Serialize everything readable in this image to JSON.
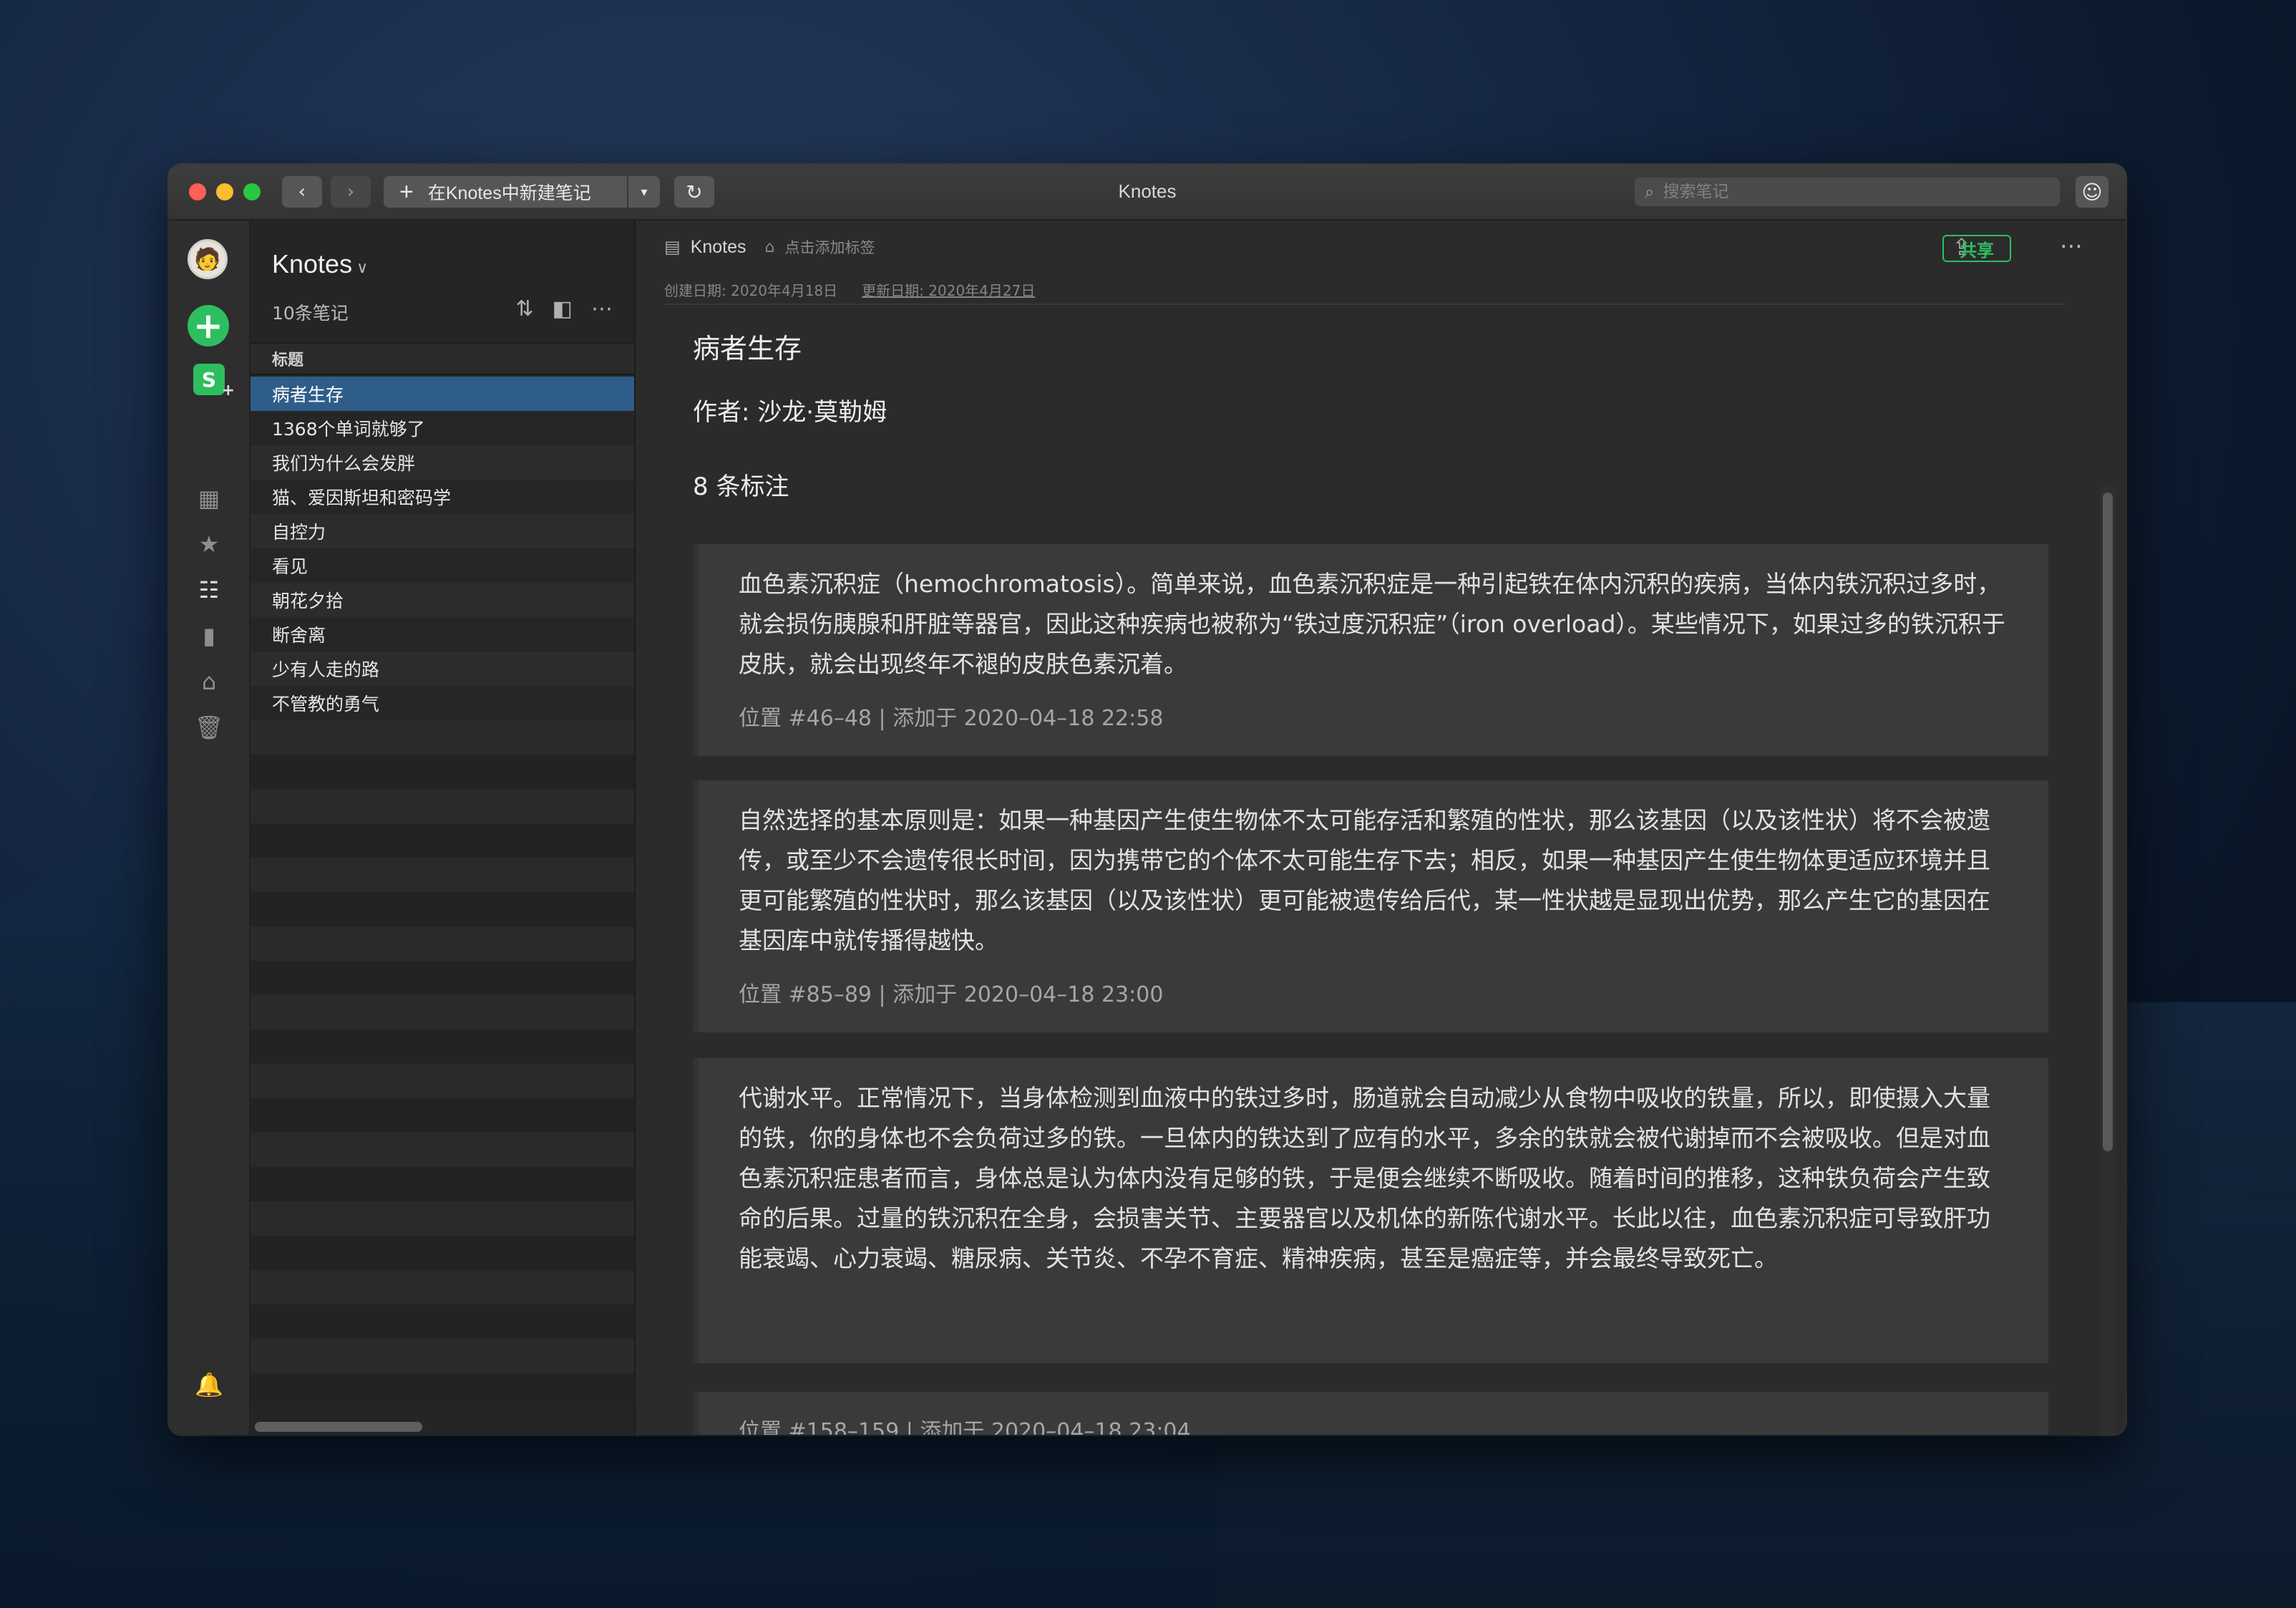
{
  "window": {
    "title": "Knotes",
    "new_note_label": "在Knotes中新建笔记",
    "search_placeholder": "搜索笔记"
  },
  "icons": {
    "back": "chevron-left-icon",
    "forward": "chevron-right-icon",
    "sync": "sync-icon",
    "search": "search-icon",
    "emoji": "smiley-icon"
  },
  "list": {
    "notebook": "Knotes",
    "count": "10条笔记",
    "column_header": "标题",
    "notes": [
      "病者生存",
      "1368个单词就够了",
      "我们为什么会发胖",
      "猫、爱因斯坦和密码学",
      "自控力",
      "看见",
      "朝花夕拾",
      "断舍离",
      "少有人走的路",
      "不管教的勇气"
    ],
    "selected_index": 0
  },
  "note": {
    "notebook": "Knotes",
    "tag_hint": "点击添加标签",
    "share_label": "共享",
    "created": "创建日期: 2020年4月18日",
    "updated": "更新日期: 2020年4月27日",
    "title": "病者生存",
    "author": "作者: 沙龙·莫勒姆",
    "highlight_count": "8 条标注",
    "highlights": [
      {
        "text": "血色素沉积症（hemochromatosis）。简单来说，血色素沉积症是一种引起铁在体内沉积的疾病，当体内铁沉积过多时，就会损伤胰腺和肝脏等器官，因此这种疾病也被称为“铁过度沉积症”（iron overload）。某些情况下，如果过多的铁沉积于皮肤，就会出现终年不褪的皮肤色素沉着。",
        "meta": "位置 #46–48 | 添加于 2020–04–18 22:58"
      },
      {
        "text": "自然选择的基本原则是：如果一种基因产生使生物体不太可能存活和繁殖的性状，那么该基因（以及该性状）将不会被遗传，或至少不会遗传很长时间，因为携带它的个体不太可能生存下去；相反，如果一种基因产生使生物体更适应环境并且更可能繁殖的性状时，那么该基因（以及该性状）更可能被遗传给后代，某一性状越是显现出优势，那么产生它的基因在基因库中就传播得越快。",
        "meta": "位置 #85–89 | 添加于 2020–04–18 23:00"
      },
      {
        "text": "代谢水平。正常情况下，当身体检测到血液中的铁过多时，肠道就会自动减少从食物中吸收的铁量，所以，即使摄入大量的铁，你的身体也不会负荷过多的铁。一旦体内的铁达到了应有的水平，多余的铁就会被代谢掉而不会被吸收。但是对血色素沉积症患者而言，身体总是认为体内没有足够的铁，于是便会继续不断吸收。随着时间的推移，这种铁负荷会产生致命的后果。过量的铁沉积在全身，会损害关节、主要器官以及机体的新陈代谢水平。长此以往，血色素沉积症可导致肝功能衰竭、心力衰竭、糖尿病、关节炎、不孕不育症、精神疾病，甚至是癌症等，并会最终导致死亡。",
        "meta": ""
      },
      {
        "text": "",
        "meta": "位置 #158–159 | 添加于 2020–04–18 23:04"
      }
    ]
  },
  "colors": {
    "accent_green": "#2dbe60",
    "selection_blue": "#2f5d89",
    "window_bg": "#2b2b2b"
  }
}
